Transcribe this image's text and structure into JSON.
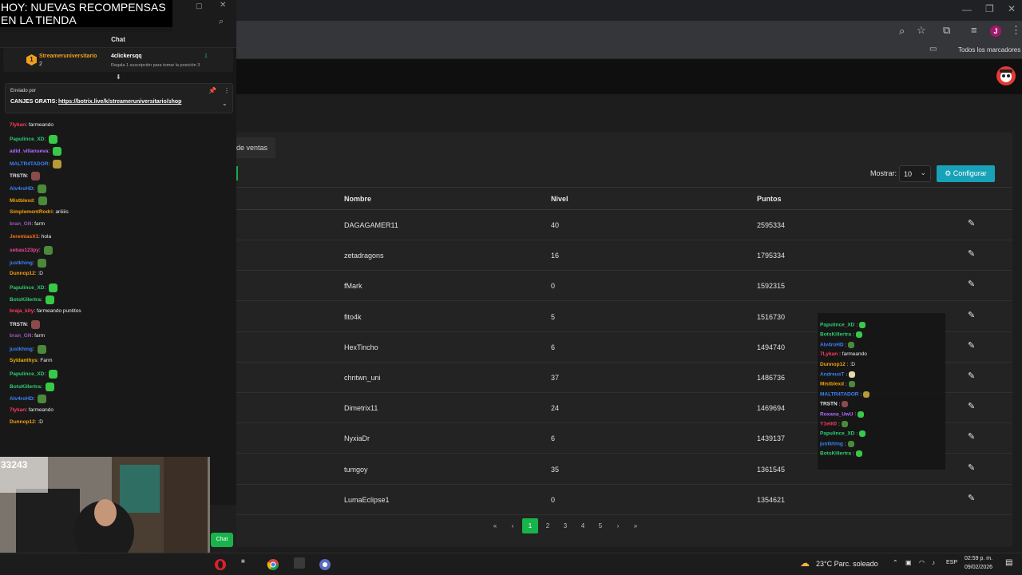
{
  "banner": {
    "text_line1": "HOY: NUEVAS RECOMPENSAS",
    "text_line2": "EN LA TIENDA"
  },
  "browser": {
    "bookmarks_folder": "Todos los marcadores",
    "profile_initial": "J"
  },
  "chat": {
    "title": "Chat",
    "leaderboard": {
      "first_user": "Streameruniversitario",
      "first_count": "2",
      "gifter": "4clickersqq",
      "gifter_count": "1",
      "hint": "Regala 1 suscripción para tomar la posición 3"
    },
    "pinned": {
      "sent_by_label": "Enviado por",
      "message_prefix": "CANJES GRATIS:",
      "link": "https://botrix.live/k/streameruniversitario/shop"
    },
    "messages": [
      {
        "user": "7lykan",
        "text": "farmeando",
        "color": "#ff3b5c"
      },
      {
        "user": "Papulince_XD",
        "text": "",
        "color": "#2ecc71",
        "emote": "#38c948"
      },
      {
        "user": "adid_villanueva",
        "text": "",
        "color": "#b36bff",
        "emote": "#38c948"
      },
      {
        "user": "MALTR4TADOR",
        "text": "",
        "color": "#3b82f6",
        "emote": "#b59b3a"
      },
      {
        "user": "TRSTN",
        "text": "",
        "color": "#e5e5e5",
        "emote": "#8b4b4b"
      },
      {
        "user": "Alv4roHD",
        "text": "",
        "color": "#3b82f6",
        "emote": "#4a8a3a"
      },
      {
        "user": "Mistblexd",
        "text": "",
        "color": "#f59e0b",
        "emote": "#4a8a3a"
      },
      {
        "user": "SimplementRodri",
        "text": "ariiiiis",
        "color": "#f59e0b"
      },
      {
        "user": "bran_GN",
        "text": "farm",
        "color": "#9b59b6"
      },
      {
        "user": "JeremiasX1",
        "text": "hola",
        "color": "#f97316"
      },
      {
        "user": "sebas123py",
        "text": "",
        "color": "#ec4899",
        "emote": "#4a8a3a"
      },
      {
        "user": "justkhing",
        "text": "",
        "color": "#3b82f6",
        "emote": "#4a8a3a"
      },
      {
        "user": "Dunnop12",
        "text": ":D",
        "color": "#f59e0b"
      },
      {
        "user": "Papulince_XD",
        "text": "",
        "color": "#2ecc71",
        "emote": "#38c948"
      },
      {
        "user": "BotsKillertra",
        "text": "",
        "color": "#2ecc71",
        "emote": "#38c948"
      },
      {
        "user": "braja_kity",
        "text": "farmeando puntitos",
        "color": "#ff3b5c"
      },
      {
        "user": "TRSTN",
        "text": "",
        "color": "#e5e5e5",
        "emote": "#8b4b4b"
      },
      {
        "user": "bran_GN",
        "text": "farm",
        "color": "#9b59b6"
      },
      {
        "user": "justkhing",
        "text": "",
        "color": "#3b82f6",
        "emote": "#4a8a3a"
      },
      {
        "user": "Syldanthys",
        "text": "Farm",
        "color": "#eab308"
      },
      {
        "user": "Papulince_XD",
        "text": "",
        "color": "#2ecc71",
        "emote": "#38c948"
      },
      {
        "user": "BotsKillertra",
        "text": "",
        "color": "#2ecc71",
        "emote": "#38c948"
      },
      {
        "user": "Alv4roHD",
        "text": "",
        "color": "#3b82f6",
        "emote": "#4a8a3a"
      },
      {
        "user": "7lykan",
        "text": "farmeando",
        "color": "#ff3b5c"
      },
      {
        "user": "Dunnop12",
        "text": ":D",
        "color": "#f59e0b"
      }
    ],
    "toggle_label": "Chat"
  },
  "webcam": {
    "counter": "33243"
  },
  "overlay_chat": [
    {
      "user": "Papulince_XD",
      "text": ":",
      "color": "#2ecc71",
      "emote": "#38c948"
    },
    {
      "user": "BotsKillertra",
      "text": ":",
      "color": "#2ecc71",
      "emote": "#38c948"
    },
    {
      "user": "Alv4roHD",
      "text": ":",
      "color": "#3b82f6",
      "emote": "#4a8a3a"
    },
    {
      "user": "7Lykan",
      "text": ": farmeando",
      "color": "#ff3b5c"
    },
    {
      "user": "Dunnop12",
      "text": ": :D",
      "color": "#f59e0b"
    },
    {
      "user": "AndreusT",
      "text": ":",
      "color": "#3b82f6",
      "emote": "#e8d9a8"
    },
    {
      "user": "Mistblexd",
      "text": ":",
      "color": "#f59e0b",
      "emote": "#4a8a3a"
    },
    {
      "user": "MALTR4TADOR",
      "text": ":",
      "color": "#3b82f6",
      "emote": "#b59b3a"
    },
    {
      "user": "TRSTN",
      "text": ":",
      "color": "#e5e5e5",
      "emote": "#8b4b4b"
    },
    {
      "user": "Roxana_UwU",
      "text": ":",
      "color": "#b36bff",
      "emote": "#38c948"
    },
    {
      "user": "Y1elit0",
      "text": ":",
      "color": "#ff3b5c",
      "emote": "#4a8a3a"
    },
    {
      "user": "Papulince_XD",
      "text": ":",
      "color": "#2ecc71",
      "emote": "#38c948"
    },
    {
      "user": "justkhing",
      "text": ":",
      "color": "#3b82f6",
      "emote": "#4a8a3a"
    },
    {
      "user": "BotsKillertra",
      "text": ":",
      "color": "#2ecc71",
      "emote": "#38c948"
    }
  ],
  "page": {
    "tab_label": "de ventas",
    "show_label": "Mostrar:",
    "show_value": "10",
    "config_label": "Configurar",
    "columns": {
      "name": "Nombre",
      "level": "Nivel",
      "points": "Puntos"
    },
    "rows": [
      {
        "name": "DAGAGAMER11",
        "level": "40",
        "points": "2595334"
      },
      {
        "name": "zetadragons",
        "level": "16",
        "points": "1795334"
      },
      {
        "name": "fMark",
        "level": "0",
        "points": "1592315"
      },
      {
        "name": "fito4k",
        "level": "5",
        "points": "1516730"
      },
      {
        "name": "HexTincho",
        "level": "6",
        "points": "1494740"
      },
      {
        "name": "chntwn_uni",
        "level": "37",
        "points": "1486736"
      },
      {
        "name": "Dimetrix11",
        "level": "24",
        "points": "1469694"
      },
      {
        "name": "NyxiaDr",
        "level": "6",
        "points": "1439137"
      },
      {
        "name": "tumgoy",
        "level": "35",
        "points": "1361545"
      },
      {
        "name": "LumaEclipse1",
        "level": "0",
        "points": "1354621"
      }
    ],
    "pagination": {
      "first": "«",
      "prev": "‹",
      "pages": [
        "1",
        "2",
        "3",
        "4",
        "5"
      ],
      "next": "›",
      "last": "»"
    }
  },
  "taskbar": {
    "weather": "23°C  Parc. soleado",
    "language": "ESP",
    "time": "02:59 p. m.",
    "date": "09/02/2026"
  }
}
